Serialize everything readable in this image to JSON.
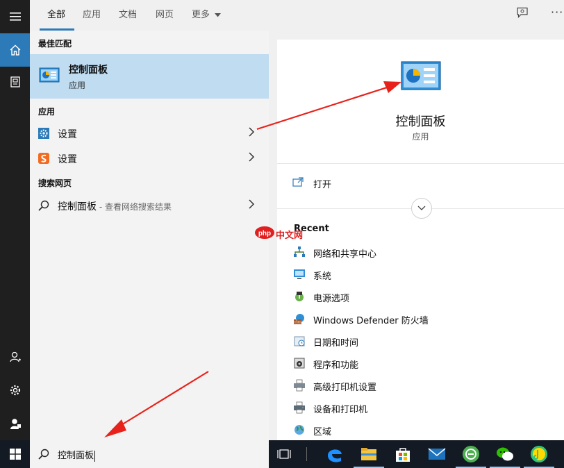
{
  "tabs": [
    {
      "label": "全部",
      "active": true
    },
    {
      "label": "应用",
      "active": false
    },
    {
      "label": "文档",
      "active": false
    },
    {
      "label": "网页",
      "active": false
    },
    {
      "label": "更多",
      "active": false
    }
  ],
  "results": {
    "best_match_heading": "最佳匹配",
    "best_match": {
      "title": "控制面板",
      "subtitle": "应用",
      "icon": "control-panel-icon"
    },
    "apps_heading": "应用",
    "apps": [
      {
        "label": "设置",
        "icon": "settings-gear-icon"
      },
      {
        "label": "设置",
        "icon": "sogou-settings-icon"
      }
    ],
    "web_heading": "搜索网页",
    "web_result": {
      "label": "控制面板",
      "suffix": " - 查看网络搜索结果",
      "icon": "search-icon"
    }
  },
  "detail": {
    "title": "控制面板",
    "subtitle": "应用",
    "open_label": "打开",
    "recent_heading": "Recent",
    "recent_items": [
      {
        "label": "网络和共享中心",
        "icon": "network-icon"
      },
      {
        "label": "系统",
        "icon": "system-icon"
      },
      {
        "label": "电源选项",
        "icon": "power-icon"
      },
      {
        "label": "Windows Defender 防火墙",
        "icon": "firewall-icon"
      },
      {
        "label": "日期和时间",
        "icon": "calendar-icon"
      },
      {
        "label": "程序和功能",
        "icon": "programs-icon"
      },
      {
        "label": "高级打印机设置",
        "icon": "printer-icon"
      },
      {
        "label": "设备和打印机",
        "icon": "devices-printers-icon"
      },
      {
        "label": "区域",
        "icon": "region-globe-icon"
      }
    ]
  },
  "watermark": {
    "text": "中文网",
    "logo_text": "php"
  },
  "taskbar": {
    "search_value": "控制面板",
    "apps": [
      "task-view-icon",
      "edge-icon",
      "file-explorer-icon",
      "store-icon",
      "mail-icon",
      "green-app-icon",
      "wechat-icon",
      "qq-music-icon"
    ]
  },
  "colors": {
    "accent": "#2d7ab8",
    "highlight": "#bfdcf0",
    "arrow": "#e8221b",
    "taskbar": "#141a24",
    "rail": "#1f1f1f"
  }
}
